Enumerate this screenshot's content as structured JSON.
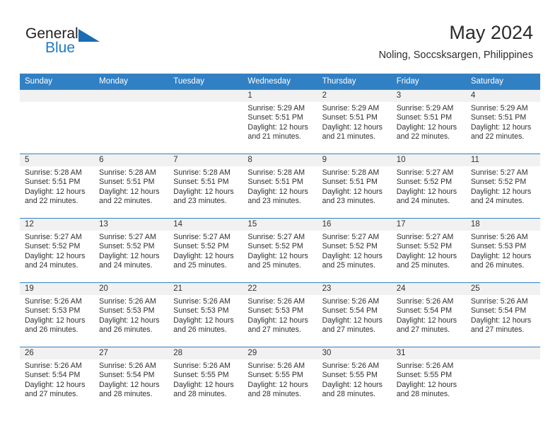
{
  "brand": {
    "name_part1": "General",
    "name_part2": "Blue",
    "accent_color": "#1f7ac4"
  },
  "header": {
    "title": "May 2024",
    "subtitle": "Noling, Soccsksargen, Philippines"
  },
  "calendar": {
    "header_bg": "#3280c4",
    "weekdays": [
      "Sunday",
      "Monday",
      "Tuesday",
      "Wednesday",
      "Thursday",
      "Friday",
      "Saturday"
    ],
    "weeks": [
      [
        {
          "day": "",
          "sunrise": "",
          "sunset": "",
          "daylight1": "",
          "daylight2": ""
        },
        {
          "day": "",
          "sunrise": "",
          "sunset": "",
          "daylight1": "",
          "daylight2": ""
        },
        {
          "day": "",
          "sunrise": "",
          "sunset": "",
          "daylight1": "",
          "daylight2": ""
        },
        {
          "day": "1",
          "sunrise": "Sunrise: 5:29 AM",
          "sunset": "Sunset: 5:51 PM",
          "daylight1": "Daylight: 12 hours",
          "daylight2": "and 21 minutes."
        },
        {
          "day": "2",
          "sunrise": "Sunrise: 5:29 AM",
          "sunset": "Sunset: 5:51 PM",
          "daylight1": "Daylight: 12 hours",
          "daylight2": "and 21 minutes."
        },
        {
          "day": "3",
          "sunrise": "Sunrise: 5:29 AM",
          "sunset": "Sunset: 5:51 PM",
          "daylight1": "Daylight: 12 hours",
          "daylight2": "and 22 minutes."
        },
        {
          "day": "4",
          "sunrise": "Sunrise: 5:29 AM",
          "sunset": "Sunset: 5:51 PM",
          "daylight1": "Daylight: 12 hours",
          "daylight2": "and 22 minutes."
        }
      ],
      [
        {
          "day": "5",
          "sunrise": "Sunrise: 5:28 AM",
          "sunset": "Sunset: 5:51 PM",
          "daylight1": "Daylight: 12 hours",
          "daylight2": "and 22 minutes."
        },
        {
          "day": "6",
          "sunrise": "Sunrise: 5:28 AM",
          "sunset": "Sunset: 5:51 PM",
          "daylight1": "Daylight: 12 hours",
          "daylight2": "and 22 minutes."
        },
        {
          "day": "7",
          "sunrise": "Sunrise: 5:28 AM",
          "sunset": "Sunset: 5:51 PM",
          "daylight1": "Daylight: 12 hours",
          "daylight2": "and 23 minutes."
        },
        {
          "day": "8",
          "sunrise": "Sunrise: 5:28 AM",
          "sunset": "Sunset: 5:51 PM",
          "daylight1": "Daylight: 12 hours",
          "daylight2": "and 23 minutes."
        },
        {
          "day": "9",
          "sunrise": "Sunrise: 5:28 AM",
          "sunset": "Sunset: 5:51 PM",
          "daylight1": "Daylight: 12 hours",
          "daylight2": "and 23 minutes."
        },
        {
          "day": "10",
          "sunrise": "Sunrise: 5:27 AM",
          "sunset": "Sunset: 5:52 PM",
          "daylight1": "Daylight: 12 hours",
          "daylight2": "and 24 minutes."
        },
        {
          "day": "11",
          "sunrise": "Sunrise: 5:27 AM",
          "sunset": "Sunset: 5:52 PM",
          "daylight1": "Daylight: 12 hours",
          "daylight2": "and 24 minutes."
        }
      ],
      [
        {
          "day": "12",
          "sunrise": "Sunrise: 5:27 AM",
          "sunset": "Sunset: 5:52 PM",
          "daylight1": "Daylight: 12 hours",
          "daylight2": "and 24 minutes."
        },
        {
          "day": "13",
          "sunrise": "Sunrise: 5:27 AM",
          "sunset": "Sunset: 5:52 PM",
          "daylight1": "Daylight: 12 hours",
          "daylight2": "and 24 minutes."
        },
        {
          "day": "14",
          "sunrise": "Sunrise: 5:27 AM",
          "sunset": "Sunset: 5:52 PM",
          "daylight1": "Daylight: 12 hours",
          "daylight2": "and 25 minutes."
        },
        {
          "day": "15",
          "sunrise": "Sunrise: 5:27 AM",
          "sunset": "Sunset: 5:52 PM",
          "daylight1": "Daylight: 12 hours",
          "daylight2": "and 25 minutes."
        },
        {
          "day": "16",
          "sunrise": "Sunrise: 5:27 AM",
          "sunset": "Sunset: 5:52 PM",
          "daylight1": "Daylight: 12 hours",
          "daylight2": "and 25 minutes."
        },
        {
          "day": "17",
          "sunrise": "Sunrise: 5:27 AM",
          "sunset": "Sunset: 5:52 PM",
          "daylight1": "Daylight: 12 hours",
          "daylight2": "and 25 minutes."
        },
        {
          "day": "18",
          "sunrise": "Sunrise: 5:26 AM",
          "sunset": "Sunset: 5:53 PM",
          "daylight1": "Daylight: 12 hours",
          "daylight2": "and 26 minutes."
        }
      ],
      [
        {
          "day": "19",
          "sunrise": "Sunrise: 5:26 AM",
          "sunset": "Sunset: 5:53 PM",
          "daylight1": "Daylight: 12 hours",
          "daylight2": "and 26 minutes."
        },
        {
          "day": "20",
          "sunrise": "Sunrise: 5:26 AM",
          "sunset": "Sunset: 5:53 PM",
          "daylight1": "Daylight: 12 hours",
          "daylight2": "and 26 minutes."
        },
        {
          "day": "21",
          "sunrise": "Sunrise: 5:26 AM",
          "sunset": "Sunset: 5:53 PM",
          "daylight1": "Daylight: 12 hours",
          "daylight2": "and 26 minutes."
        },
        {
          "day": "22",
          "sunrise": "Sunrise: 5:26 AM",
          "sunset": "Sunset: 5:53 PM",
          "daylight1": "Daylight: 12 hours",
          "daylight2": "and 27 minutes."
        },
        {
          "day": "23",
          "sunrise": "Sunrise: 5:26 AM",
          "sunset": "Sunset: 5:54 PM",
          "daylight1": "Daylight: 12 hours",
          "daylight2": "and 27 minutes."
        },
        {
          "day": "24",
          "sunrise": "Sunrise: 5:26 AM",
          "sunset": "Sunset: 5:54 PM",
          "daylight1": "Daylight: 12 hours",
          "daylight2": "and 27 minutes."
        },
        {
          "day": "25",
          "sunrise": "Sunrise: 5:26 AM",
          "sunset": "Sunset: 5:54 PM",
          "daylight1": "Daylight: 12 hours",
          "daylight2": "and 27 minutes."
        }
      ],
      [
        {
          "day": "26",
          "sunrise": "Sunrise: 5:26 AM",
          "sunset": "Sunset: 5:54 PM",
          "daylight1": "Daylight: 12 hours",
          "daylight2": "and 27 minutes."
        },
        {
          "day": "27",
          "sunrise": "Sunrise: 5:26 AM",
          "sunset": "Sunset: 5:54 PM",
          "daylight1": "Daylight: 12 hours",
          "daylight2": "and 28 minutes."
        },
        {
          "day": "28",
          "sunrise": "Sunrise: 5:26 AM",
          "sunset": "Sunset: 5:55 PM",
          "daylight1": "Daylight: 12 hours",
          "daylight2": "and 28 minutes."
        },
        {
          "day": "29",
          "sunrise": "Sunrise: 5:26 AM",
          "sunset": "Sunset: 5:55 PM",
          "daylight1": "Daylight: 12 hours",
          "daylight2": "and 28 minutes."
        },
        {
          "day": "30",
          "sunrise": "Sunrise: 5:26 AM",
          "sunset": "Sunset: 5:55 PM",
          "daylight1": "Daylight: 12 hours",
          "daylight2": "and 28 minutes."
        },
        {
          "day": "31",
          "sunrise": "Sunrise: 5:26 AM",
          "sunset": "Sunset: 5:55 PM",
          "daylight1": "Daylight: 12 hours",
          "daylight2": "and 28 minutes."
        },
        {
          "day": "",
          "sunrise": "",
          "sunset": "",
          "daylight1": "",
          "daylight2": ""
        }
      ]
    ]
  }
}
